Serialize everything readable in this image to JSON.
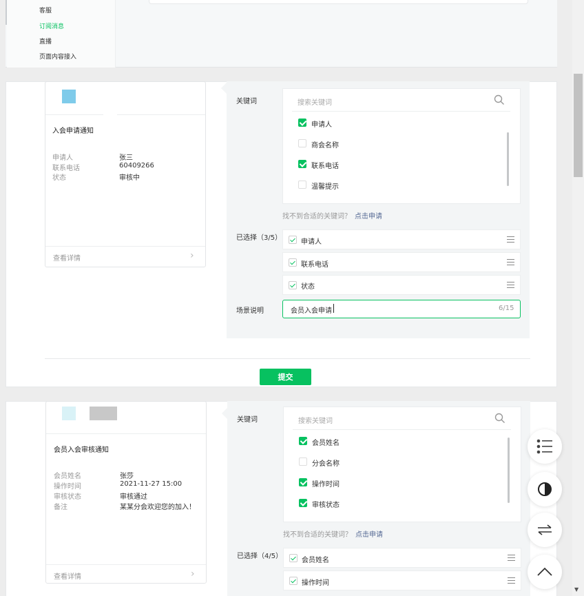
{
  "top_menu": {
    "items": [
      "客服",
      "订阅消息",
      "直播",
      "页面内容接入"
    ],
    "active_index": 1
  },
  "template1": {
    "card": {
      "title": "入会申请通知",
      "fields": [
        {
          "key": "申请人",
          "value": "张三"
        },
        {
          "key": "联系电话",
          "value": "60409266"
        },
        {
          "key": "状态",
          "value": "审核中"
        }
      ],
      "footer": "查看详情"
    },
    "keywords_label": "关键词",
    "search_placeholder": "搜索关键词",
    "keyword_options": [
      {
        "label": "申请人",
        "checked": true
      },
      {
        "label": "商会名称",
        "checked": false
      },
      {
        "label": "联系电话",
        "checked": true
      },
      {
        "label": "温馨提示",
        "checked": false
      }
    ],
    "hint_text": "找不到合适的关键词？",
    "hint_link": "点击申请",
    "selected_label": "已选择（3/5）",
    "selected_items": [
      "申请人",
      "联系电话",
      "状态"
    ],
    "scene_label": "场景说明",
    "scene_value": "会员入会申请",
    "scene_count": "6/15",
    "submit_label": "提交"
  },
  "template2": {
    "card": {
      "title": "会员入会审核通知",
      "fields": [
        {
          "key": "会员姓名",
          "value": "张莎"
        },
        {
          "key": "操作时间",
          "value": "2021-11-27 15:00"
        },
        {
          "key": "审核状态",
          "value": "审核通过"
        },
        {
          "key": "备注",
          "value": "某某分会欢迎您的加入！"
        }
      ],
      "footer": "查看详情"
    },
    "keywords_label": "关键词",
    "search_placeholder": "搜索关键词",
    "keyword_options": [
      {
        "label": "会员姓名",
        "checked": true
      },
      {
        "label": "分会名称",
        "checked": false
      },
      {
        "label": "操作时间",
        "checked": true
      },
      {
        "label": "审核状态",
        "checked": true
      }
    ],
    "hint_text": "找不到合适的关键词？",
    "hint_link": "点击申请",
    "selected_label": "已选择（4/5）",
    "selected_items": [
      "会员姓名",
      "操作时间"
    ]
  },
  "floating_buttons": [
    "list-icon",
    "contrast-icon",
    "swap-icon",
    "back-to-top-icon"
  ],
  "colors": {
    "accent": "#07c160",
    "link": "#576b95",
    "panel_bg": "#f3f5f6"
  }
}
